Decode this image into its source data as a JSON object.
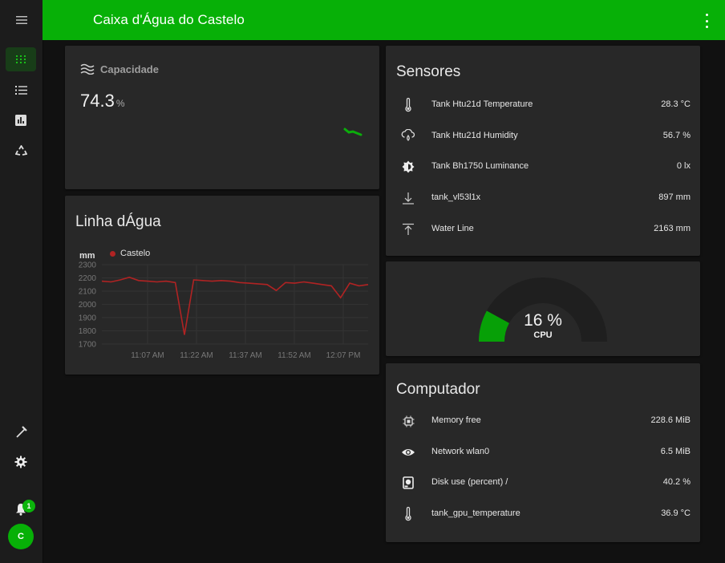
{
  "header": {
    "title": "Caixa d'Água do Castelo"
  },
  "sidebar": {
    "items": [
      {
        "icon": "grid-icon"
      },
      {
        "icon": "list-icon"
      },
      {
        "icon": "chart-icon"
      },
      {
        "icon": "recycle-icon"
      }
    ],
    "bottom": [
      {
        "icon": "hammer-icon"
      },
      {
        "icon": "gear-icon"
      },
      {
        "icon": "bell-icon"
      }
    ],
    "notification_count": "1",
    "avatar_initial": "C"
  },
  "capacity": {
    "label": "Capacidade",
    "value": "74.3",
    "unit": "%"
  },
  "waterline_chart": {
    "title": "Linha dÁgua",
    "unit": "mm",
    "legend": "Castelo",
    "y_ticks": [
      "2300",
      "2200",
      "2100",
      "2000",
      "1900",
      "1800",
      "1700"
    ],
    "x_ticks": [
      "11:07 AM",
      "11:22 AM",
      "11:37 AM",
      "11:52 AM",
      "12:07 PM"
    ]
  },
  "chart_data": {
    "type": "line",
    "xlabel": "",
    "ylabel": "mm",
    "ylim": [
      1700,
      2300
    ],
    "x": [
      "10:58",
      "11:00",
      "11:03",
      "11:06",
      "11:09",
      "11:12",
      "11:15",
      "11:18",
      "11:21",
      "11:22",
      "11:23",
      "11:25",
      "11:28",
      "11:31",
      "11:34",
      "11:37",
      "11:40",
      "11:43",
      "11:46",
      "11:48",
      "11:50",
      "11:53",
      "11:56",
      "11:59",
      "12:02",
      "12:05",
      "12:06",
      "12:07",
      "12:08",
      "12:10"
    ],
    "series": [
      {
        "name": "Castelo",
        "color": "#b02323",
        "values": [
          2175,
          2170,
          2185,
          2205,
          2180,
          2175,
          2170,
          2175,
          2165,
          1770,
          2185,
          2180,
          2175,
          2180,
          2175,
          2165,
          2160,
          2155,
          2150,
          2105,
          2165,
          2160,
          2170,
          2160,
          2150,
          2140,
          2050,
          2160,
          2140,
          2150
        ]
      }
    ]
  },
  "sensors": {
    "title": "Sensores",
    "rows": [
      {
        "icon": "thermometer-icon",
        "name": "Tank Htu21d Temperature",
        "value": "28.3 °C"
      },
      {
        "icon": "cloud-drop-icon",
        "name": "Tank Htu21d Humidity",
        "value": "56.7 %"
      },
      {
        "icon": "brightness-icon",
        "name": "Tank Bh1750 Luminance",
        "value": "0 lx"
      },
      {
        "icon": "arrow-down-icon",
        "name": "tank_vl53l1x",
        "value": "897 mm"
      },
      {
        "icon": "arrow-up-icon",
        "name": "Water Line",
        "value": "2163 mm"
      }
    ]
  },
  "cpu_gauge": {
    "value": "16 %",
    "label": "CPU",
    "percent": 16,
    "color": "#07a007",
    "track_color": "#1f1f1f"
  },
  "computer": {
    "title": "Computador",
    "rows": [
      {
        "icon": "memory-icon",
        "name": "Memory free",
        "value": "228.6 MiB"
      },
      {
        "icon": "eye-icon",
        "name": "Network wlan0",
        "value": "6.5 MiB"
      },
      {
        "icon": "harddisk-icon",
        "name": "Disk use (percent) /",
        "value": "40.2 %"
      },
      {
        "icon": "thermometer-icon",
        "name": "tank_gpu_temperature",
        "value": "36.9 °C"
      }
    ]
  },
  "colors": {
    "accent": "#07b007",
    "background": "#111111",
    "card": "#282828",
    "line": "#b02323"
  }
}
